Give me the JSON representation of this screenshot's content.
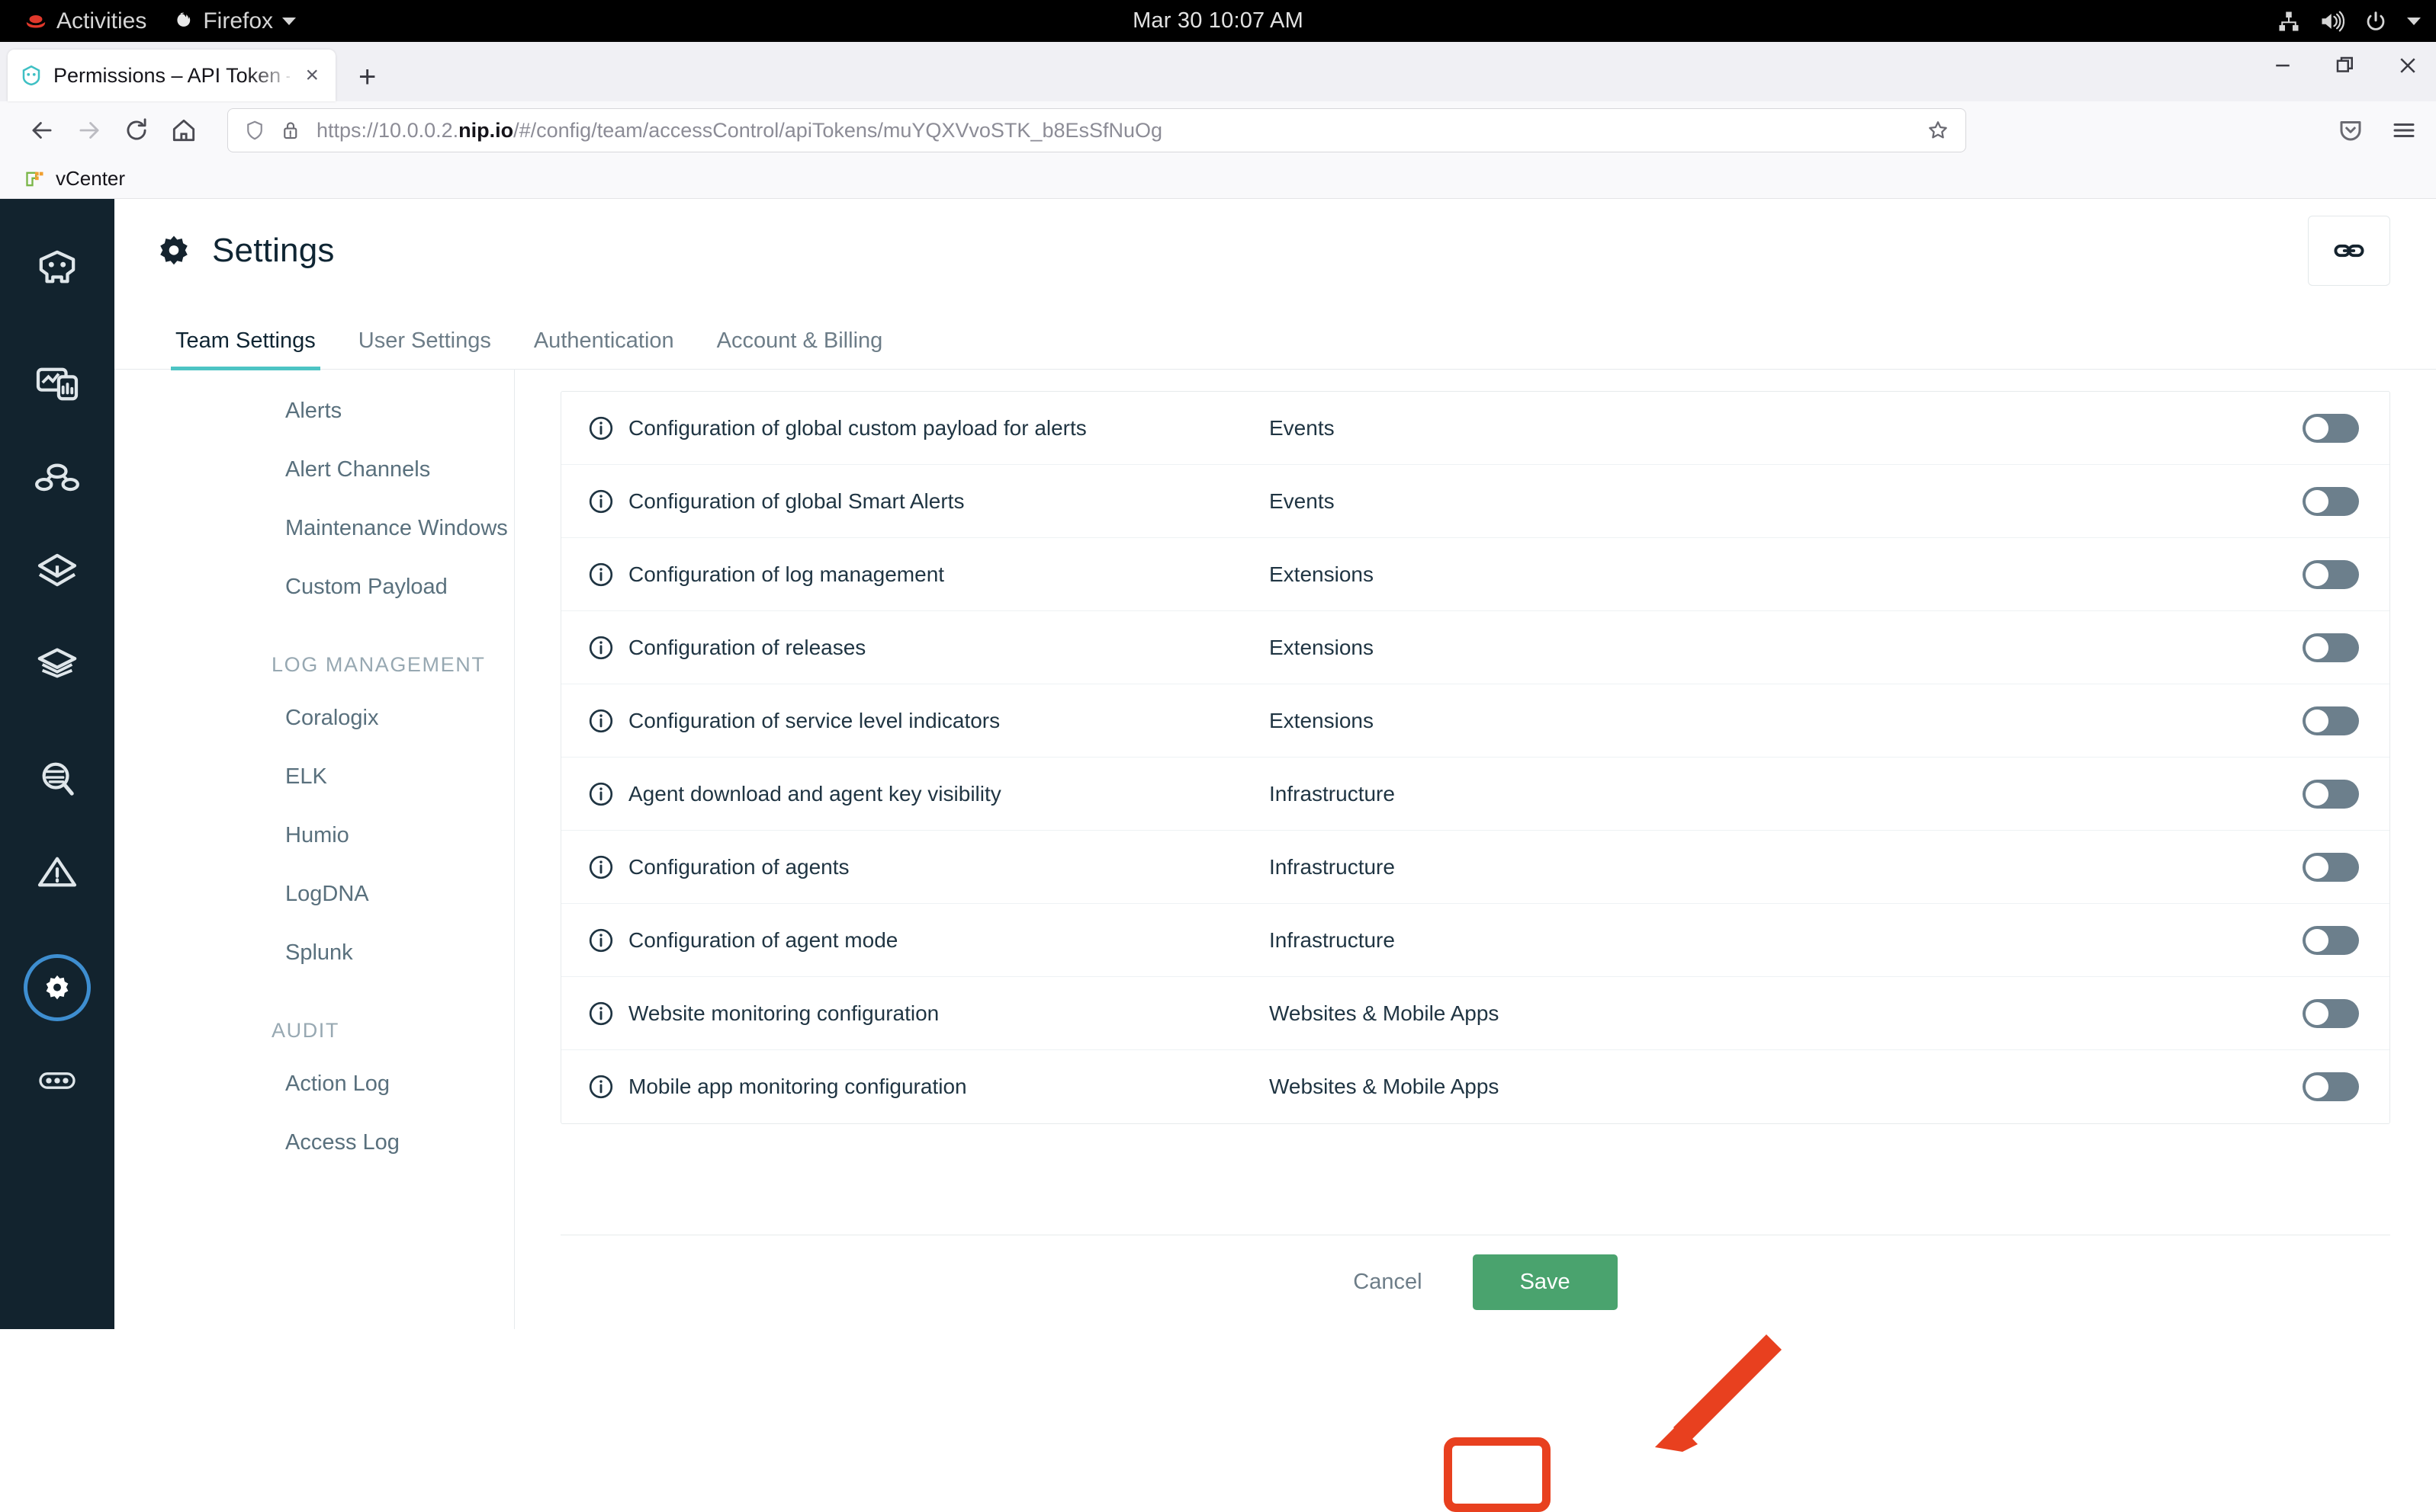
{
  "desktop": {
    "activities_label": "Activities",
    "app_menu_label": "Firefox",
    "clock": "Mar 30  10:07 AM",
    "tray_icons": [
      "network-icon",
      "volume-icon",
      "power-icon",
      "chevron-down-icon"
    ]
  },
  "browser": {
    "tab": {
      "title": "Permissions – API Token –",
      "favicon": "instana-favicon",
      "close_label": "×"
    },
    "new_tab_label": "+",
    "window_controls": [
      "minimize-button",
      "restore-button",
      "close-button"
    ],
    "nav": {
      "back": "back-arrow-icon",
      "forward": "forward-arrow-icon",
      "reload": "reload-icon",
      "home": "home-icon"
    },
    "url": {
      "prefix": "https://10.0.0.2.",
      "emphasis": "nip.io",
      "suffix": "/#/config/team/accessControl/apiTokens/muYQXVvoSTK_b8EsSfNuOg",
      "full": "https://10.0.0.2.nip.io/#/config/team/accessControl/apiTokens/muYQXVvoSTK_b8EsSfNuOg"
    },
    "toolbar_icons": [
      "shield-icon",
      "lock-warning-icon",
      "bookmark-star-icon",
      "pocket-icon",
      "hamburger-menu-icon"
    ],
    "bookmarks": [
      {
        "label": "vCenter",
        "icon": "vcenter-icon"
      }
    ]
  },
  "app": {
    "nav_icons": [
      "instana-robot-logo-icon",
      "dashboards-icon",
      "applications-icon",
      "services-icon",
      "stack-layers-icon",
      "analytics-search-icon",
      "events-warning-icon",
      "settings-gear-icon",
      "more-options-icon"
    ],
    "header": {
      "title": "Settings",
      "title_icon": "gear-icon",
      "link_button_icon": "chain-link-icon"
    },
    "tabs": [
      {
        "label": "Team Settings",
        "active": true
      },
      {
        "label": "User Settings",
        "active": false
      },
      {
        "label": "Authentication",
        "active": false
      },
      {
        "label": "Account & Billing",
        "active": false
      }
    ],
    "sidebar": [
      {
        "type": "item",
        "label": "Alerts"
      },
      {
        "type": "item",
        "label": "Alert Channels"
      },
      {
        "type": "item",
        "label": "Maintenance Windows"
      },
      {
        "type": "item",
        "label": "Custom Payload"
      },
      {
        "type": "heading",
        "label": "LOG MANAGEMENT"
      },
      {
        "type": "item",
        "label": "Coralogix"
      },
      {
        "type": "item",
        "label": "ELK"
      },
      {
        "type": "item",
        "label": "Humio"
      },
      {
        "type": "item",
        "label": "LogDNA"
      },
      {
        "type": "item",
        "label": "Splunk"
      },
      {
        "type": "heading",
        "label": "AUDIT"
      },
      {
        "type": "item",
        "label": "Action Log"
      },
      {
        "type": "item",
        "label": "Access Log"
      }
    ],
    "permissions": [
      {
        "name": "Configuration of global custom payload for alerts",
        "category": "Events",
        "enabled": false
      },
      {
        "name": "Configuration of global Smart Alerts",
        "category": "Events",
        "enabled": false
      },
      {
        "name": "Configuration of log management",
        "category": "Extensions",
        "enabled": false
      },
      {
        "name": "Configuration of releases",
        "category": "Extensions",
        "enabled": false
      },
      {
        "name": "Configuration of service level indicators",
        "category": "Extensions",
        "enabled": false
      },
      {
        "name": "Agent download and agent key visibility",
        "category": "Infrastructure",
        "enabled": false
      },
      {
        "name": "Configuration of agents",
        "category": "Infrastructure",
        "enabled": false
      },
      {
        "name": "Configuration of agent mode",
        "category": "Infrastructure",
        "enabled": false
      },
      {
        "name": "Website monitoring configuration",
        "category": "Websites & Mobile Apps",
        "enabled": false
      },
      {
        "name": "Mobile app monitoring configuration",
        "category": "Websites & Mobile Apps",
        "enabled": false
      }
    ],
    "footer": {
      "cancel_label": "Cancel",
      "save_label": "Save"
    },
    "annotation": {
      "target": "save-button",
      "color": "#e8401f",
      "shape": "rounded-rectangle-with-arrow"
    },
    "colors": {
      "accent_teal": "#4dc4c4",
      "nav_dark": "#12232e",
      "save_green": "#4aa36e",
      "annotation_red": "#e8401f",
      "toggle_off": "#6c7f8c"
    }
  }
}
